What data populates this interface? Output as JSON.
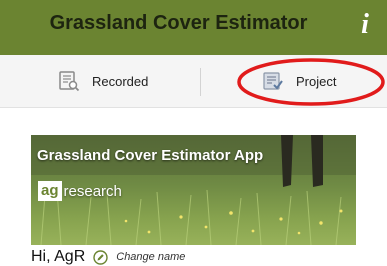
{
  "header": {
    "title": "Grassland Cover Estimator",
    "info_icon": "info-icon"
  },
  "tabs": [
    {
      "label": "Recorded",
      "icon": "recorded-list-icon"
    },
    {
      "label": "Project",
      "icon": "project-checklist-icon"
    }
  ],
  "annotation": {
    "color": "#e11b1b",
    "shape": "ellipse around Project tab"
  },
  "banner": {
    "title": "Grassland Cover Estimator App",
    "logo_mark": "ag",
    "logo_word": "research"
  },
  "greeting": {
    "text": "Hi, AgR",
    "change_label": "Change name"
  },
  "colors": {
    "header_bg": "#6b8431",
    "tabbar_bg": "#f5f5f5",
    "accent": "#6b8431"
  }
}
